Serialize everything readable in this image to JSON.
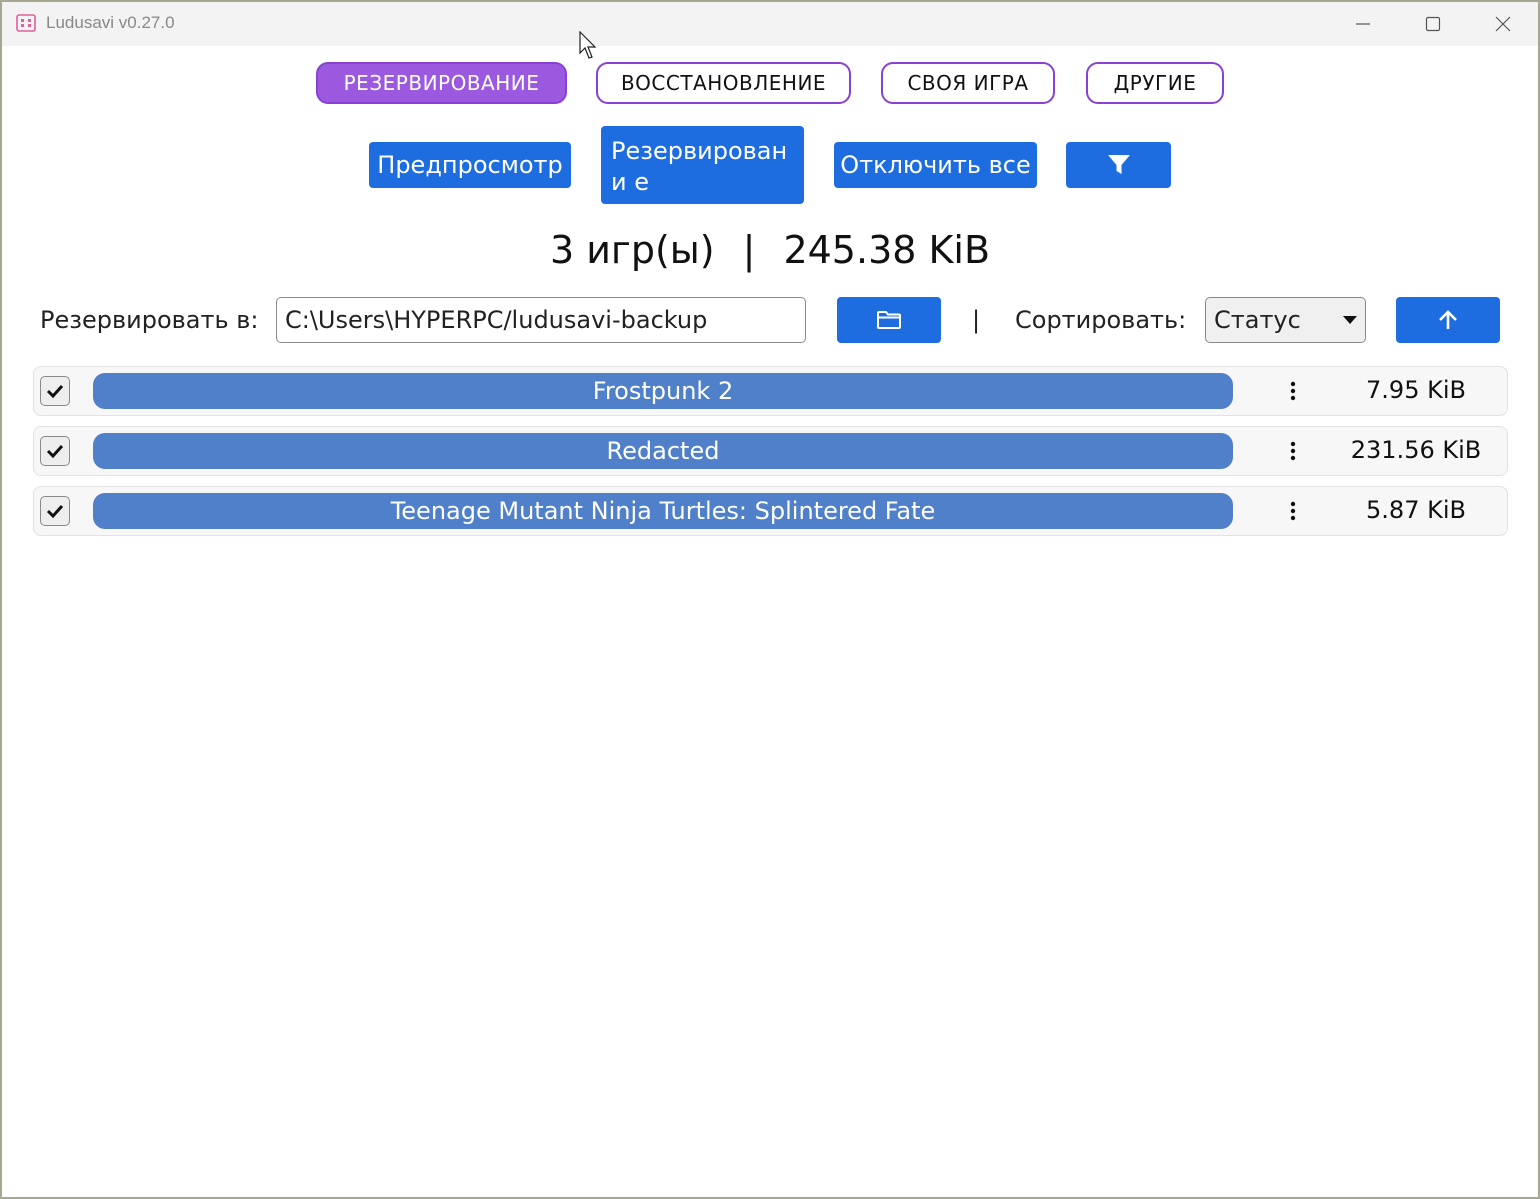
{
  "window": {
    "title": "Ludusavi v0.27.0"
  },
  "nav": {
    "tabs": [
      {
        "label": "РЕЗЕРВИРОВАНИЕ",
        "active": true
      },
      {
        "label": "ВОССТАНОВЛЕНИЕ",
        "active": false
      },
      {
        "label": "СВОЯ ИГРА",
        "active": false
      },
      {
        "label": "ДРУГИЕ",
        "active": false
      }
    ]
  },
  "toolbar": {
    "preview_label": "Предпросмотр",
    "backup_label": "Резервировани е",
    "deselect_all_label": "Отключить все",
    "filter_icon": "filter-icon"
  },
  "summary": {
    "games": "3 игр(ы)",
    "separator": "|",
    "total_size": "245.38 KiB"
  },
  "backup_target": {
    "label": "Резервировать в:",
    "path": "C:\\Users\\HYPERPC/ludusavi-backup",
    "browse_icon": "folder-icon"
  },
  "sort": {
    "separator": "|",
    "label": "Сортировать:",
    "selected": "Статус",
    "direction_icon": "arrow-up-icon"
  },
  "games": [
    {
      "checked": true,
      "name": "Frostpunk 2",
      "size": "7.95 KiB"
    },
    {
      "checked": true,
      "name": "Redacted",
      "size": "231.56 KiB"
    },
    {
      "checked": true,
      "name": "Teenage Mutant Ninja Turtles: Splintered Fate",
      "size": "5.87 KiB"
    }
  ],
  "colors": {
    "accent_purple": "#9b59e0",
    "button_blue": "#1e6de0",
    "game_bar_blue": "#4f80c9"
  }
}
